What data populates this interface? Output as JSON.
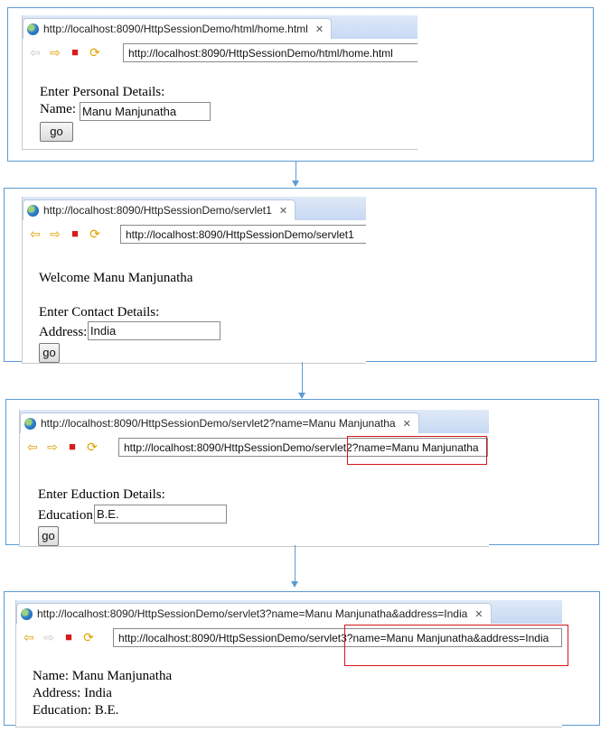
{
  "steps": [
    {
      "tab_title": "http://localhost:8090/HttpSessionDemo/html/home.html",
      "url": "http://localhost:8090/HttpSessionDemo/html/home.html",
      "heading": "Enter Personal Details:",
      "field_label": "Name:",
      "field_value": "Manu Manjunatha",
      "button_label": "go"
    },
    {
      "tab_title": "http://localhost:8090/HttpSessionDemo/servlet1",
      "url": "http://localhost:8090/HttpSessionDemo/servlet1",
      "welcome": "Welcome Manu Manjunatha",
      "heading": "Enter Contact Details:",
      "field_label": "Address:",
      "field_value": "India",
      "button_label": "go"
    },
    {
      "tab_title": "http://localhost:8090/HttpSessionDemo/servlet2?name=Manu Manjunatha",
      "url": "http://localhost:8090/HttpSessionDemo/servlet2?name=Manu Manjunatha",
      "heading": "Enter Eduction Details:",
      "field_label": "Education:",
      "field_value": "B.E.",
      "button_label": "go"
    },
    {
      "tab_title": "http://localhost:8090/HttpSessionDemo/servlet3?name=Manu Manjunatha&address=India",
      "url": "http://localhost:8090/HttpSessionDemo/servlet3?name=Manu Manjunatha&address=India",
      "result_lines": [
        "Name: Manu Manjunatha",
        "Address: India",
        "Education: B.E."
      ]
    }
  ],
  "icons": {
    "back": "back-arrow-icon",
    "forward": "forward-arrow-icon",
    "stop": "stop-icon",
    "refresh": "refresh-icon",
    "close": "close-tab-icon",
    "globe": "globe-icon"
  },
  "colors": {
    "frame_border": "#5b9bd5",
    "highlight": "#d3171a",
    "tabbar": "#c7d9f3"
  }
}
